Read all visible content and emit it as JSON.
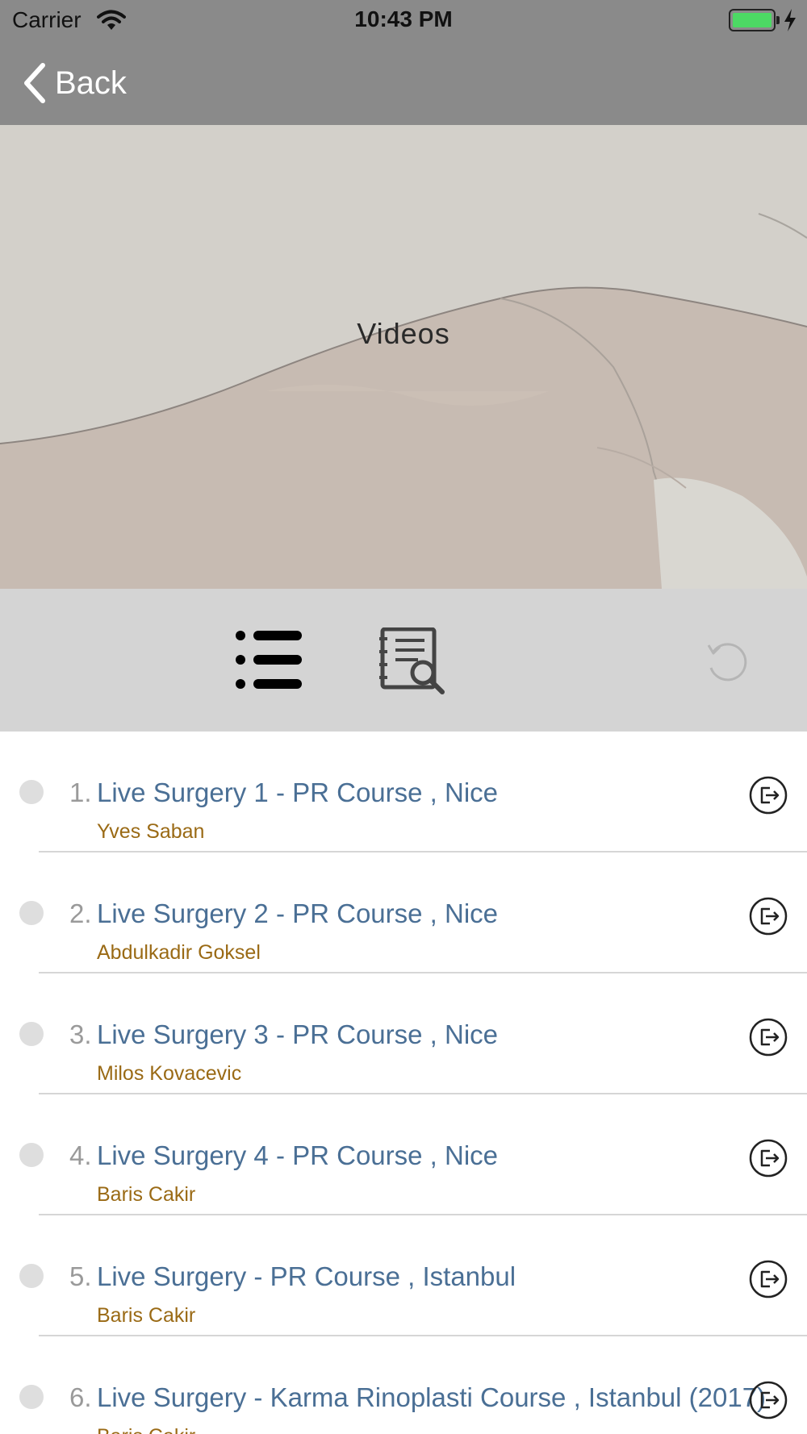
{
  "status_bar": {
    "carrier": "Carrier",
    "time": "10:43 PM",
    "battery_color": "#4cd964"
  },
  "nav": {
    "back_label": "Back",
    "back_icon": "chevron-left-icon"
  },
  "hero": {
    "title": "Videos"
  },
  "toolbar": {
    "list_icon": "list-icon",
    "catalog_icon": "catalog-search-icon",
    "refresh_icon": "refresh-icon"
  },
  "videos": [
    {
      "index": "1.",
      "title": "Live Surgery 1 - PR Course , Nice",
      "author": "Yves Saban"
    },
    {
      "index": "2.",
      "title": "Live Surgery 2 - PR Course , Nice",
      "author": "Abdulkadir Goksel"
    },
    {
      "index": "3.",
      "title": "Live Surgery 3 - PR Course , Nice",
      "author": "Milos Kovacevic"
    },
    {
      "index": "4.",
      "title": "Live Surgery 4 - PR Course , Nice",
      "author": "Baris Cakir"
    },
    {
      "index": "5.",
      "title": "Live Surgery - PR Course , Istanbul",
      "author": "Baris Cakir"
    },
    {
      "index": "6.",
      "title": "Live Surgery - Karma Rinoplasti Course , Istanbul (2017)",
      "author": "Baris Cakir"
    }
  ],
  "colors": {
    "bar_gray": "#8a8a8a",
    "toolbar_gray": "#d4d4d4",
    "title_blue": "#4a6f95",
    "author_brown": "#9a6a15"
  }
}
